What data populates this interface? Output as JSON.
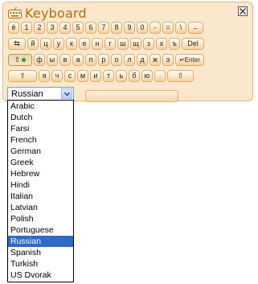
{
  "window": {
    "title": "Keyboard",
    "close_icon": "close-x-icon"
  },
  "rows": [
    [
      "ё",
      "1",
      "2",
      "3",
      "4",
      "5",
      "6",
      "7",
      "8",
      "9",
      "0",
      "-",
      "=",
      "\\",
      "←"
    ],
    [
      "⇆",
      "й",
      "ц",
      "у",
      "к",
      "е",
      "н",
      "г",
      "ш",
      "щ",
      "з",
      "х",
      "ъ",
      "Del"
    ],
    [
      "⇧",
      "ф",
      "ы",
      "в",
      "а",
      "п",
      "р",
      "о",
      "л",
      "д",
      "ж",
      "э",
      "↵Enter"
    ],
    [
      "⇧",
      "я",
      "ч",
      "с",
      "м",
      "и",
      "т",
      "ь",
      "б",
      "ю",
      ".",
      "⇧"
    ]
  ],
  "language": {
    "selected": "Russian",
    "options": [
      "Arabic",
      "Dutch",
      "Farsi",
      "French",
      "German",
      "Greek",
      "Hebrew",
      "Hindi",
      "Italian",
      "Latvian",
      "Polish",
      "Portuguese",
      "Russian",
      "Spanish",
      "Turkish",
      "US Dvorak"
    ]
  },
  "colors": {
    "frame_bg": "#fbe8cc",
    "title": "#b56a11",
    "selection": "#316ac5",
    "capslock_led": "#2f9a2f"
  }
}
